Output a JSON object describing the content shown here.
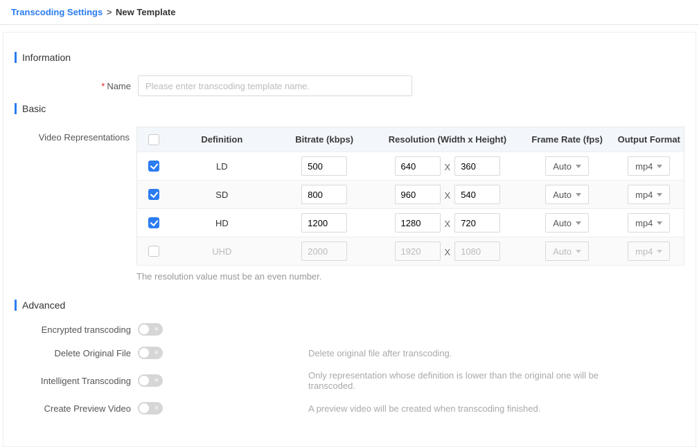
{
  "breadcrumb": {
    "parent": "Transcoding Settings",
    "sep": ">",
    "current": "New Template"
  },
  "sections": {
    "information": "Information",
    "basic": "Basic",
    "advanced": "Advanced"
  },
  "info": {
    "name_label": "Name",
    "name_placeholder": "Please enter transcoding template name.",
    "name_value": ""
  },
  "basic": {
    "repr_label": "Video Representations",
    "headers": {
      "definition": "Definition",
      "bitrate": "Bitrate (kbps)",
      "resolution": "Resolution (Width x Height)",
      "framerate": "Frame Rate (fps)",
      "format": "Output Format"
    },
    "x_sep": "X",
    "rows": [
      {
        "checked": true,
        "enabled": true,
        "def": "LD",
        "bitrate": "500",
        "w": "640",
        "h": "360",
        "fr": "Auto",
        "fmt": "mp4"
      },
      {
        "checked": true,
        "enabled": true,
        "def": "SD",
        "bitrate": "800",
        "w": "960",
        "h": "540",
        "fr": "Auto",
        "fmt": "mp4"
      },
      {
        "checked": true,
        "enabled": true,
        "def": "HD",
        "bitrate": "1200",
        "w": "1280",
        "h": "720",
        "fr": "Auto",
        "fmt": "mp4"
      },
      {
        "checked": false,
        "enabled": false,
        "def": "UHD",
        "bitrate": "2000",
        "w": "1920",
        "h": "1080",
        "fr": "Auto",
        "fmt": "mp4"
      }
    ],
    "note": "The resolution value must be an even number."
  },
  "advanced": {
    "encrypted": {
      "label": "Encrypted transcoding",
      "on": false,
      "desc": ""
    },
    "delete_orig": {
      "label": "Delete Original File",
      "on": false,
      "desc": "Delete original file after transcoding."
    },
    "intelligent": {
      "label": "Intelligent Transcoding",
      "on": false,
      "desc": "Only representation whose definition is lower than the original one will be transcoded."
    },
    "preview": {
      "label": "Create Preview Video",
      "on": false,
      "desc": "A preview video will be created when transcoding finished."
    }
  }
}
